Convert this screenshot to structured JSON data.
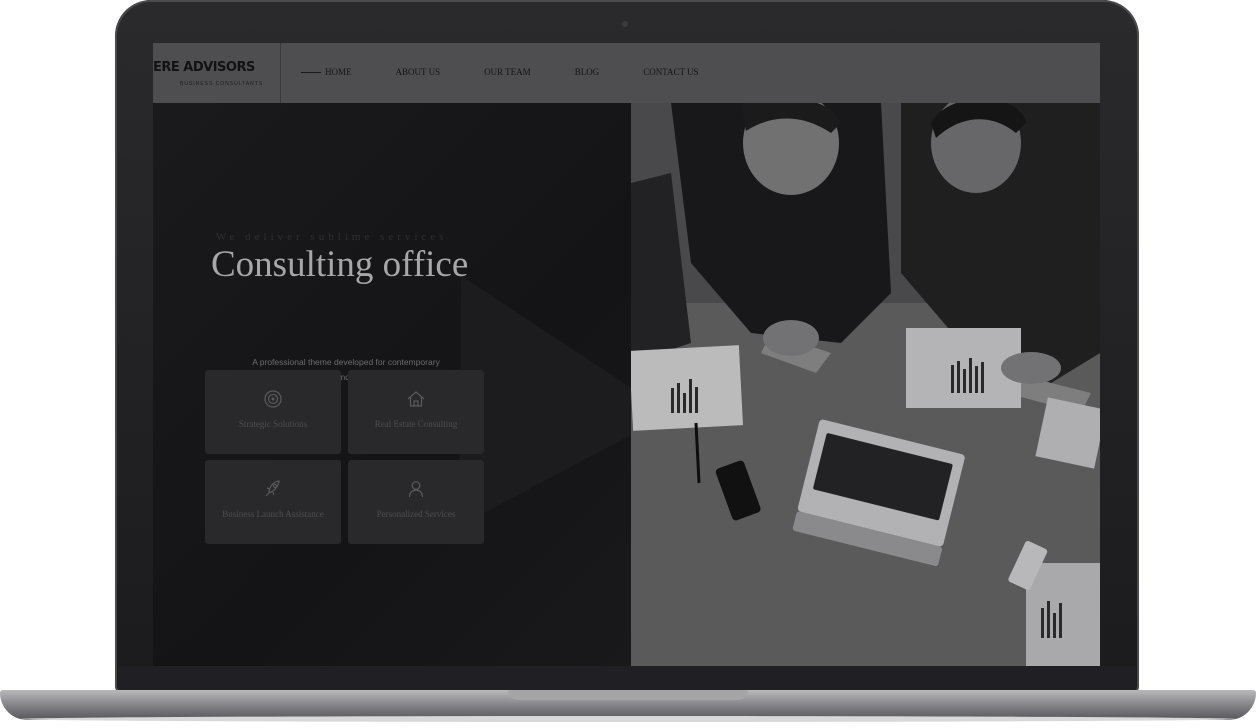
{
  "header": {
    "brand_name": "ERE ADVISORS",
    "brand_tagline": "BUSINESS CONSULTANTS",
    "nav": [
      "HOME",
      "ABOUT US",
      "OUR TEAM",
      "BLOG",
      "CONTACT US"
    ]
  },
  "hero": {
    "kicker": "We deliver sublime services",
    "title": "Consulting office",
    "description": "A professional theme developed for contemporary business advisory and corporate websites."
  },
  "services": [
    {
      "label": "Strategic Solutions",
      "icon": "target-icon"
    },
    {
      "label": "Real Estate Consulting",
      "icon": "home-icon"
    },
    {
      "label": "Business Launch Assistance",
      "icon": "rocket-icon"
    },
    {
      "label": "Personalized Services",
      "icon": "user-icon"
    }
  ],
  "colors": {
    "header_bg": "#4e4e50",
    "hero_bg": "#17171a",
    "card_bg": "#29292c",
    "title": "#a7a7aa"
  }
}
